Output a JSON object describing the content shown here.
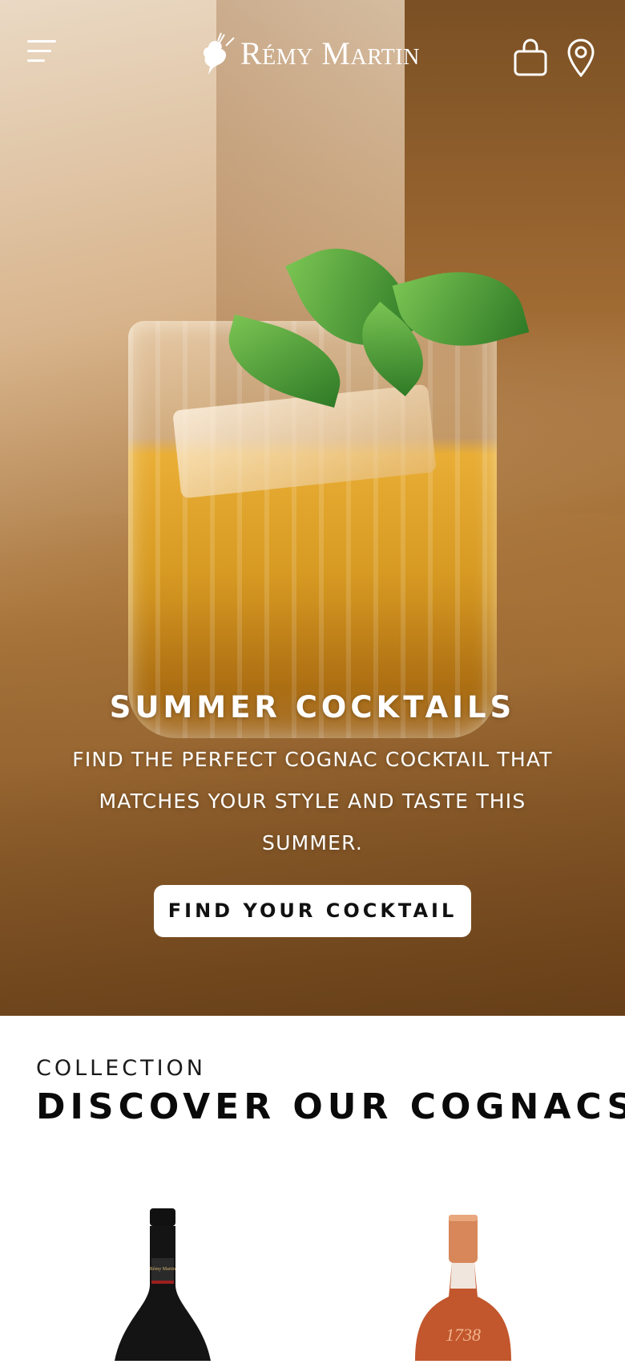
{
  "header": {
    "brand_name": "Rémy Martin",
    "menu_icon": "hamburger-menu-icon",
    "bag_icon": "shopping-bag-icon",
    "location_icon": "location-pin-icon"
  },
  "hero": {
    "title": "SUMMER COCKTAILS",
    "subtitle": "FIND THE PERFECT COGNAC COCKTAIL THAT MATCHES YOUR STYLE AND TASTE THIS SUMMER.",
    "cta_label": "FIND YOUR COCKTAIL"
  },
  "collection": {
    "eyebrow": "COLLECTION",
    "title": "DISCOVER OUR COGNACS",
    "products": [
      {
        "label_text": "Rémy Martin",
        "bottle_color": "#111111"
      },
      {
        "label_text": "1738",
        "bottle_color": "#c2562c"
      }
    ]
  },
  "colors": {
    "cta_background": "#ffffff",
    "header_text": "#ffffff",
    "page_background": "#ffffff"
  }
}
